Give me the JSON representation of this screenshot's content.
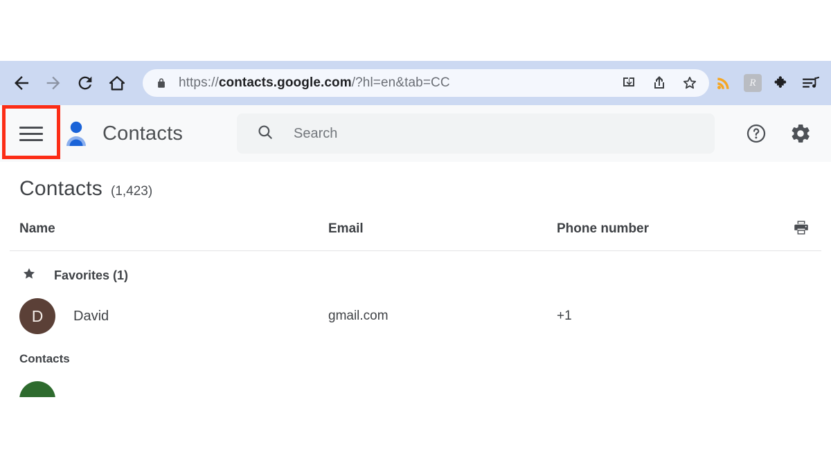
{
  "browser": {
    "nav": {
      "back_label": "Back",
      "forward_label": "Forward",
      "reload_label": "Reload",
      "home_label": "Home"
    },
    "url_full": "https://contacts.google.com/?hl=en&tab=CC",
    "url_scheme": "https://",
    "url_host": "contacts.google.com",
    "url_path": "/?hl=en&tab=CC",
    "omnibox_icons": [
      "download-icon",
      "share-icon",
      "bookmark-star-icon"
    ],
    "extension_icons": [
      "rss-feed-icon",
      "extension-badge-icon",
      "puzzle-extensions-icon",
      "reading-list-icon"
    ],
    "extension_badge_letter": "R",
    "colors": {
      "toolbar_bg": "#ccd9f2",
      "omnibox_bg": "#f4f7fd",
      "rss_orange": "#f5a623"
    }
  },
  "app_header": {
    "menu_label": "Main menu",
    "brand_title": "Contacts",
    "search": {
      "placeholder": "Search",
      "value": ""
    },
    "help_label": "Support",
    "settings_label": "Settings",
    "bg_color": "#f8f9fa"
  },
  "highlight": {
    "target": "hamburger-menu-button",
    "color": "#fc2d16"
  },
  "main": {
    "page_title": "Contacts",
    "page_count": "(1,423)",
    "print_label": "Print",
    "columns": {
      "name": "Name",
      "email": "Email",
      "phone": "Phone number"
    },
    "groups": [
      {
        "label": "Favorites (1)",
        "icon": "star-icon",
        "rows": [
          {
            "initial": "D",
            "avatar_color": "#5b4037",
            "name": "David",
            "email": "gmail.com",
            "phone": "+1"
          }
        ]
      }
    ],
    "section_label": "Contacts",
    "partial_row": {
      "avatar_color": "#2e6b2e"
    }
  }
}
